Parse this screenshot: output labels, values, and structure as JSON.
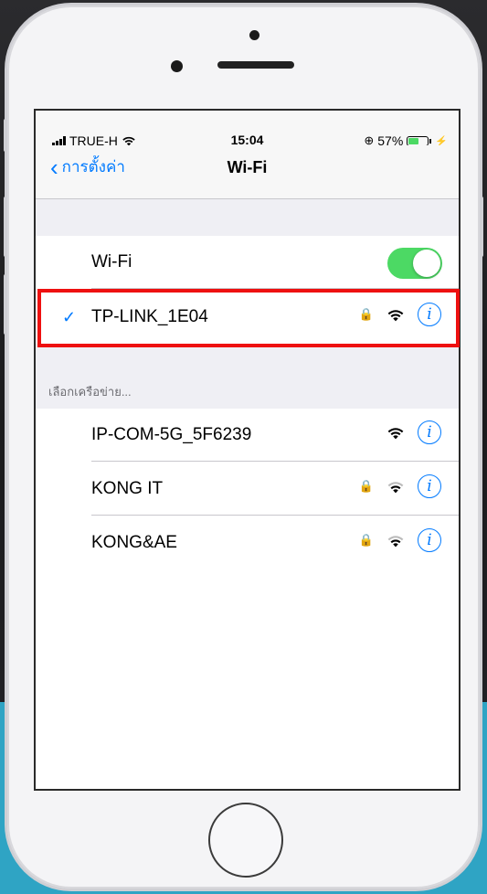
{
  "status_bar": {
    "carrier": "TRUE-H",
    "time": "15:04",
    "battery_percent": "57%",
    "battery_level": 0.57
  },
  "nav": {
    "back_label": "การตั้งค่า",
    "title": "Wi-Fi"
  },
  "wifi_toggle": {
    "label": "Wi-Fi",
    "enabled": true
  },
  "connected_network": {
    "name": "TP-LINK_1E04",
    "secured": true
  },
  "section_header": "เลือกเครือข่าย...",
  "networks": [
    {
      "name": "IP-COM-5G_5F6239",
      "secured": false
    },
    {
      "name": "KONG IT",
      "secured": true
    },
    {
      "name": "KONG&AE",
      "secured": true
    }
  ],
  "colors": {
    "accent": "#007aff",
    "toggle_on": "#4cd964",
    "highlight_border": "#ee1010"
  }
}
